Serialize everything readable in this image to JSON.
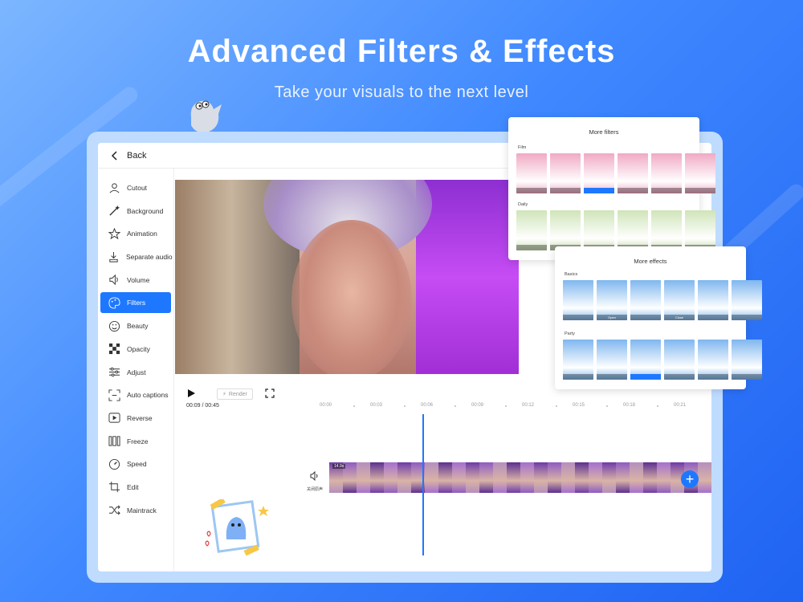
{
  "hero": {
    "headline": "Advanced Filters & Effects",
    "subline": "Take your visuals to the next level"
  },
  "topbar": {
    "back_label": "Back"
  },
  "sidebar": {
    "items": [
      {
        "label": "Cutout",
        "icon": "cutout-icon"
      },
      {
        "label": "Background",
        "icon": "magic-wand-icon"
      },
      {
        "label": "Animation",
        "icon": "star-icon"
      },
      {
        "label": "Separate audio",
        "icon": "audio-split-icon"
      },
      {
        "label": "Volume",
        "icon": "speaker-icon"
      },
      {
        "label": "Filters",
        "icon": "palette-icon",
        "active": true
      },
      {
        "label": "Beauty",
        "icon": "smile-icon"
      },
      {
        "label": "Opacity",
        "icon": "checker-icon"
      },
      {
        "label": "Adjust",
        "icon": "sliders-icon"
      },
      {
        "label": "Auto captions",
        "icon": "captions-icon"
      },
      {
        "label": "Reverse",
        "icon": "reverse-icon"
      },
      {
        "label": "Freeze",
        "icon": "freeze-icon"
      },
      {
        "label": "Speed",
        "icon": "speed-icon"
      },
      {
        "label": "Edit",
        "icon": "crop-icon"
      },
      {
        "label": "Maintrack",
        "icon": "shuffle-icon"
      }
    ]
  },
  "controls": {
    "render_label": "Render",
    "time": "00:09 / 00:45",
    "ruler": [
      "00:00",
      "00:03",
      "00:06",
      "00:09",
      "00:12",
      "00:15",
      "00:18",
      "00:21"
    ]
  },
  "timeline": {
    "audio_label": "关闭原声",
    "badge": "14.9s"
  },
  "filters_panel": {
    "title": "More filters",
    "sections": [
      {
        "name": "Film",
        "thumbs": [
          "",
          "",
          "",
          "",
          "",
          ""
        ],
        "selected": 2
      },
      {
        "name": "Daily",
        "thumbs": [
          "",
          "",
          "",
          "",
          "",
          ""
        ],
        "selected": -1
      }
    ]
  },
  "effects_panel": {
    "title": "More effects",
    "sections": [
      {
        "name": "Basics",
        "thumbs": [
          "",
          "Open",
          "",
          "Close",
          "",
          ""
        ],
        "selected": -1
      },
      {
        "name": "Party",
        "thumbs": [
          "",
          "",
          "",
          "",
          "",
          ""
        ],
        "selected": 2
      }
    ]
  },
  "colors": {
    "accent": "#1e78ff",
    "film_thumb": "#f0a9c4",
    "daily_thumb": "#cfe4b9",
    "effect_thumb": "#7fb7ef"
  }
}
